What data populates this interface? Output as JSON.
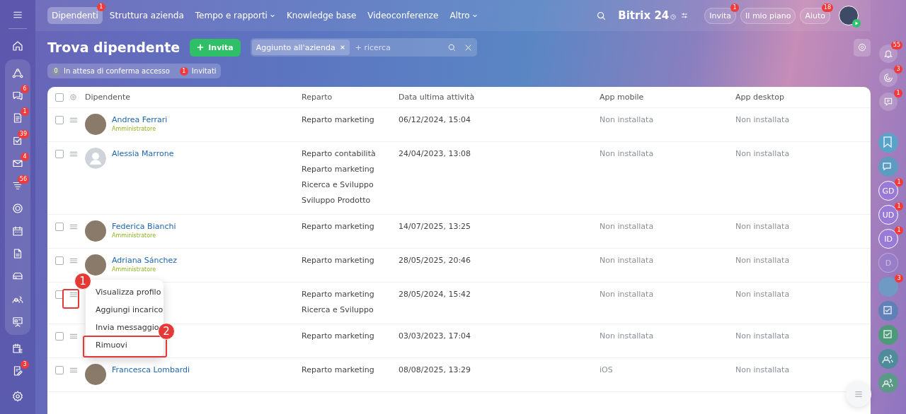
{
  "top_nav": {
    "tabs": [
      {
        "label": "Dipendenti",
        "selected": true,
        "badge": "1",
        "dropdown": false
      },
      {
        "label": "Struttura azienda",
        "selected": false,
        "dropdown": false
      },
      {
        "label": "Tempo e rapporti",
        "selected": false,
        "dropdown": true
      },
      {
        "label": "Knowledge base",
        "selected": false,
        "dropdown": false
      },
      {
        "label": "Videoconferenze",
        "selected": false,
        "dropdown": false
      },
      {
        "label": "Altro",
        "selected": false,
        "dropdown": true
      }
    ]
  },
  "header": {
    "logo": "Bitrix 24",
    "buttons": [
      {
        "label": "Invita",
        "badge": "1"
      },
      {
        "label": "Il mio piano"
      },
      {
        "label": "Aiuto",
        "badge": "18"
      }
    ]
  },
  "left_sidebar": {
    "badges": {
      "chat": "6",
      "document": "1",
      "tasks": "39",
      "mail": "4",
      "filter": "56",
      "edit": "3"
    }
  },
  "right_sidebar": {
    "top": [
      {
        "badge": "55"
      },
      {
        "badge": "3"
      },
      {
        "badge": "1"
      }
    ],
    "items": [
      {
        "kind": "icon"
      },
      {
        "kind": "icon"
      },
      {
        "kind": "initials",
        "initials": "GD",
        "badge": "1",
        "muted": false
      },
      {
        "kind": "initials",
        "initials": "UD",
        "badge": "1",
        "muted": false
      },
      {
        "kind": "initials",
        "initials": "ID",
        "badge": "1",
        "muted": false
      },
      {
        "kind": "initials",
        "initials": "D",
        "muted": true
      },
      {
        "kind": "avatar",
        "badge": "3"
      },
      {
        "kind": "icon"
      },
      {
        "kind": "icon"
      },
      {
        "kind": "icon"
      },
      {
        "kind": "icon"
      }
    ]
  },
  "page": {
    "title": "Trova dipendente",
    "invite_button": "Invita",
    "filter": {
      "chip": "Aggiunto all'azienda",
      "placeholder": "+ ricerca"
    },
    "counters": [
      {
        "count": "0",
        "label": "In attesa di conferma accesso",
        "color": "#8a93a0"
      },
      {
        "count": "1",
        "label": "Invitati",
        "color": "#ef3b3b"
      }
    ]
  },
  "table": {
    "select_all_checked": false,
    "columns": [
      "Dipendente",
      "Reparto",
      "Data ultima attività",
      "App mobile",
      "App desktop"
    ],
    "rows": [
      {
        "checked": false,
        "photo": true,
        "name": "Andrea Ferrari",
        "role": "Amministratore",
        "departments": [
          "Reparto marketing"
        ],
        "last_activity": "06/12/2024, 15:04",
        "app_mobile": "Non installata",
        "app_desktop": "Non installata"
      },
      {
        "checked": false,
        "photo": false,
        "name": "Alessia Marrone",
        "departments": [
          "Reparto contabilità",
          "Reparto marketing",
          "Ricerca e Sviluppo",
          "Sviluppo Prodotto"
        ],
        "last_activity": "24/04/2023, 13:08",
        "app_mobile": "Non installata",
        "app_desktop": "Non installata"
      },
      {
        "checked": false,
        "photo": true,
        "name": "Federica Bianchi",
        "role": "Amministratore",
        "departments": [
          "Reparto marketing"
        ],
        "last_activity": "14/07/2025, 13:25",
        "app_mobile": "Non installata",
        "app_desktop": "Non installata"
      },
      {
        "checked": false,
        "photo": true,
        "name": "Adriana Sánchez",
        "role": "Amministratore",
        "departments": [
          "Reparto marketing"
        ],
        "last_activity": "28/05/2025, 20:46",
        "app_mobile": "Non installata",
        "app_desktop": "Non installata"
      },
      {
        "checked": false,
        "handle_marker": "1",
        "menu_open": true,
        "departments": [
          "Reparto marketing",
          "Ricerca e Sviluppo"
        ],
        "last_activity": "28/05/2024, 15:42",
        "app_mobile": "Non installata",
        "app_desktop": "Non installata"
      },
      {
        "checked": false,
        "departments": [
          "Reparto marketing"
        ],
        "last_activity": "03/03/2023, 17:04",
        "app_mobile": "Non installata",
        "app_desktop": "Non installata"
      },
      {
        "checked": false,
        "photo": true,
        "name": "Francesca Lombardi",
        "departments": [
          "Reparto marketing"
        ],
        "last_activity": "08/08/2025, 13:29",
        "app_mobile": "iOS",
        "app_desktop": "Non installata"
      }
    ]
  },
  "context_menu": {
    "items": [
      {
        "label": "Visualizza profilo"
      },
      {
        "label": "Aggiungi incarico"
      },
      {
        "label": "Invia messaggio"
      },
      {
        "label": "Rimuovi",
        "marker": "2"
      }
    ]
  }
}
